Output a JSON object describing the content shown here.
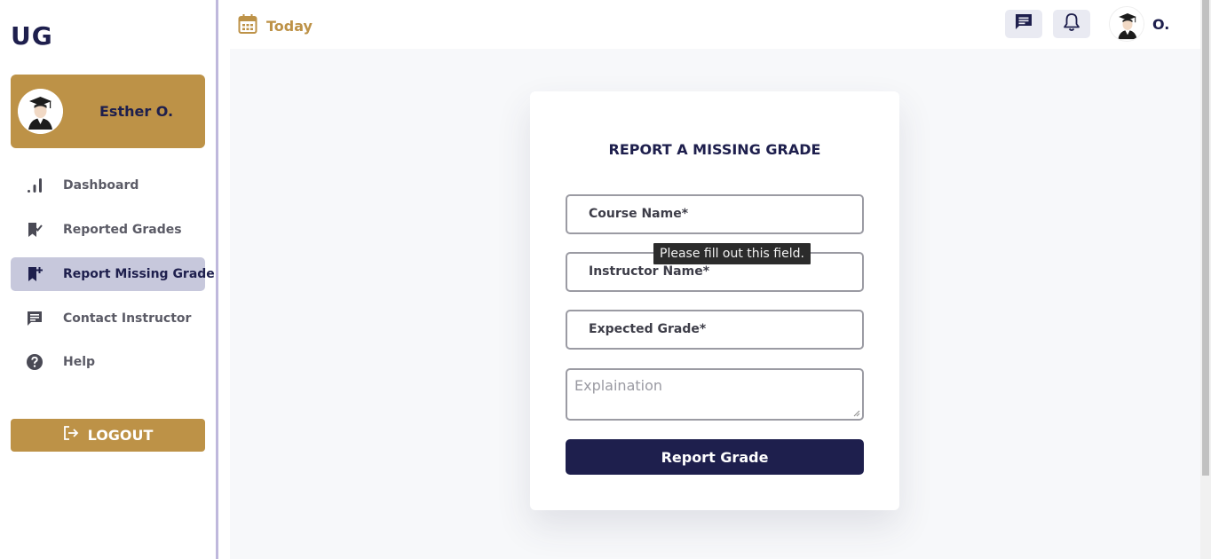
{
  "app": {
    "logo": "UG"
  },
  "sidebar": {
    "profile_name": "Esther O.",
    "items": [
      {
        "label": "Dashboard",
        "icon": "bar-chart-icon"
      },
      {
        "label": "Reported Grades",
        "icon": "bookmark-check-icon"
      },
      {
        "label": "Report Missing Grade",
        "icon": "bookmark-plus-icon",
        "active": true
      },
      {
        "label": "Contact Instructor",
        "icon": "message-icon"
      },
      {
        "label": "Help",
        "icon": "help-circle-icon"
      }
    ],
    "logout_label": "LOGOUT"
  },
  "topbar": {
    "date_label": "Today",
    "user_short_name": "O."
  },
  "form": {
    "title": "REPORT A MISSING GRADE",
    "course_name_label": "Course Name*",
    "instructor_name_label": "Instructor Name*",
    "expected_grade_label": "Expected Grade*",
    "explanation_placeholder": "Explaination",
    "submit_label": "Report Grade",
    "validation_tooltip": "Please fill out this field."
  },
  "colors": {
    "brand_gold": "#bd9247",
    "brand_navy": "#1e1f4d",
    "active_nav_bg": "#c7c8dc"
  }
}
